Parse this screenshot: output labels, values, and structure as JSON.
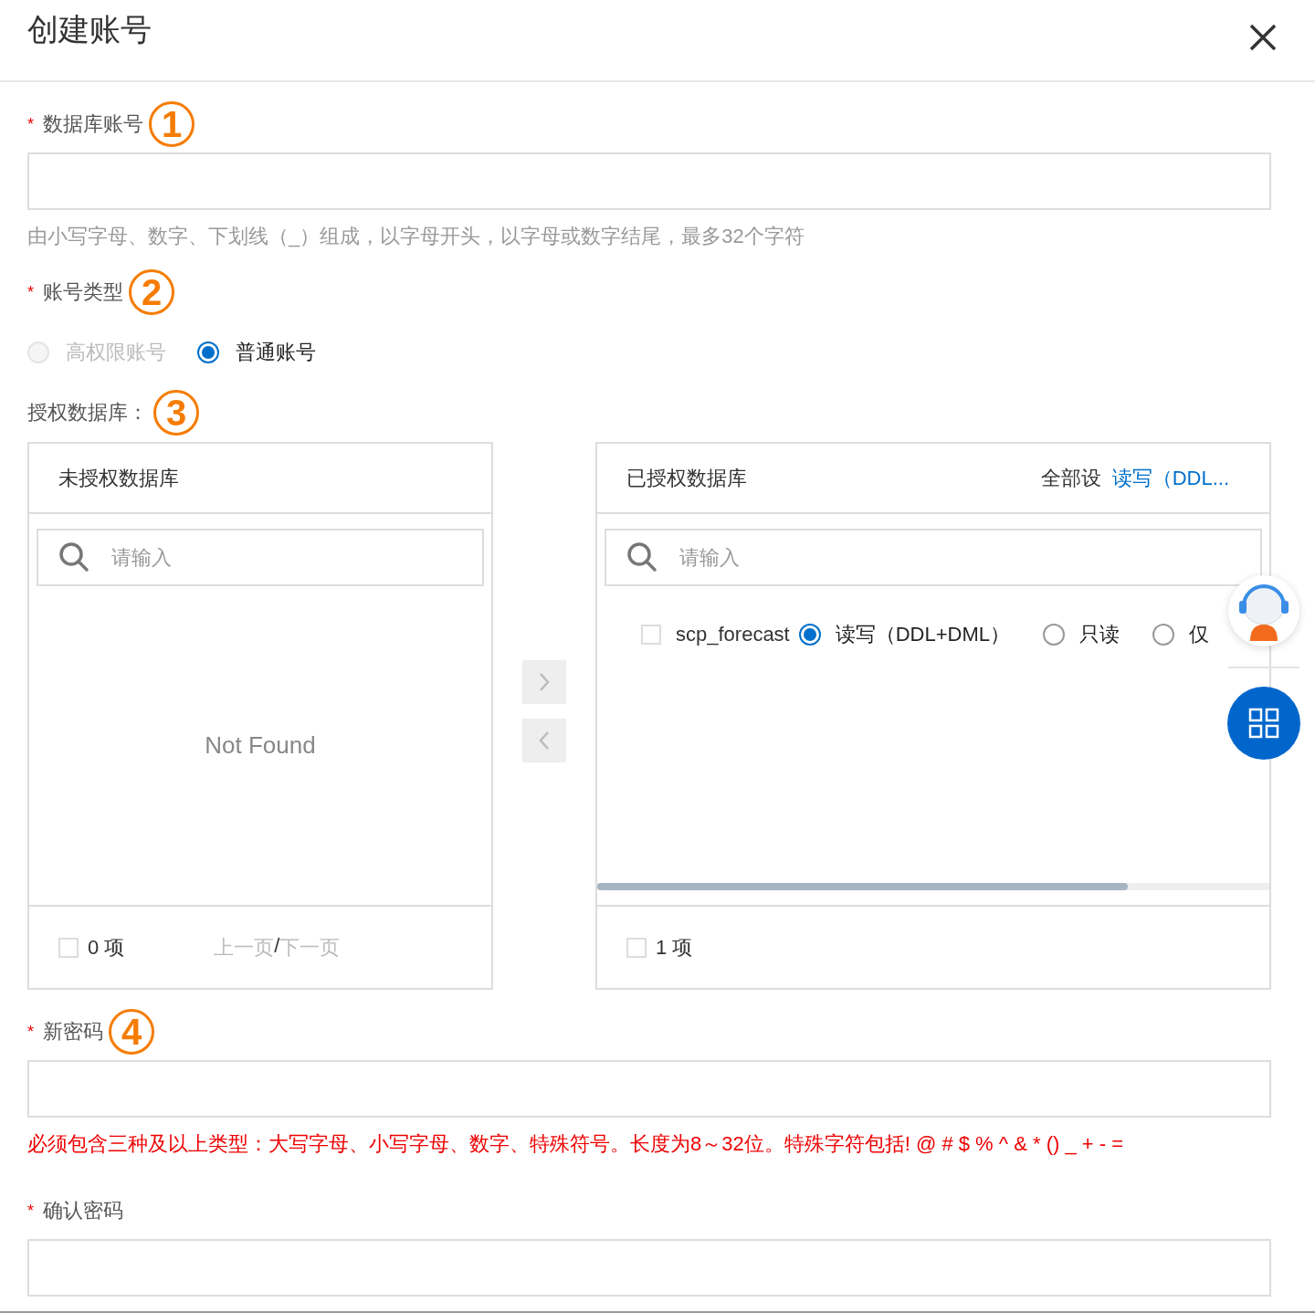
{
  "dialog": {
    "title": "创建账号"
  },
  "account": {
    "label": "数据库账号",
    "required": "*",
    "marker": "1",
    "hint": {
      "text": "由小写字母、数字、下划线（_）组成，以字母开头，以字母或数字结尾，最多32个字符",
      "kind": "info"
    }
  },
  "account_type": {
    "label": "账号类型",
    "required": "*",
    "marker": "2",
    "options": [
      {
        "label": "高权限账号",
        "selected": false,
        "disabled": true
      },
      {
        "label": "普通账号",
        "selected": true,
        "disabled": false
      }
    ]
  },
  "databases": {
    "label": "授权数据库：",
    "marker": "3",
    "source": {
      "title": "未授权数据库",
      "search_placeholder": "请输入",
      "empty": "Not Found",
      "checked": false,
      "count": "0 项",
      "prev": {
        "label": "上一页",
        "disabled": true
      },
      "separator": "/",
      "next": {
        "label": "下一页",
        "disabled": true
      }
    },
    "transfer_buttons": [
      {
        "kind": "right",
        "disabled": true
      },
      {
        "kind": "left",
        "disabled": true
      }
    ],
    "target": {
      "title": "已授权数据库",
      "set_all": "全部设",
      "set_all_link": "读写（DDL...",
      "search_placeholder": "请输入",
      "checked": false,
      "count": "1 项",
      "items": [
        {
          "name": "scp_forecast",
          "checked": false,
          "permissions": [
            {
              "label": "读写（DDL+DML）",
              "selected": true
            },
            {
              "label": "只读",
              "selected": false
            },
            {
              "label": "仅",
              "selected": false
            }
          ]
        }
      ]
    }
  },
  "password": {
    "label": "新密码",
    "required": "*",
    "marker": "4",
    "hint": {
      "text": "必须包含三种及以上类型：大写字母、小写字母、数字、特殊符号。长度为8～32位。特殊字符包括! @ # $ % ^ & * () _ + - =",
      "kind": "error"
    }
  },
  "confirm": {
    "label": "确认密码",
    "required": "*"
  }
}
